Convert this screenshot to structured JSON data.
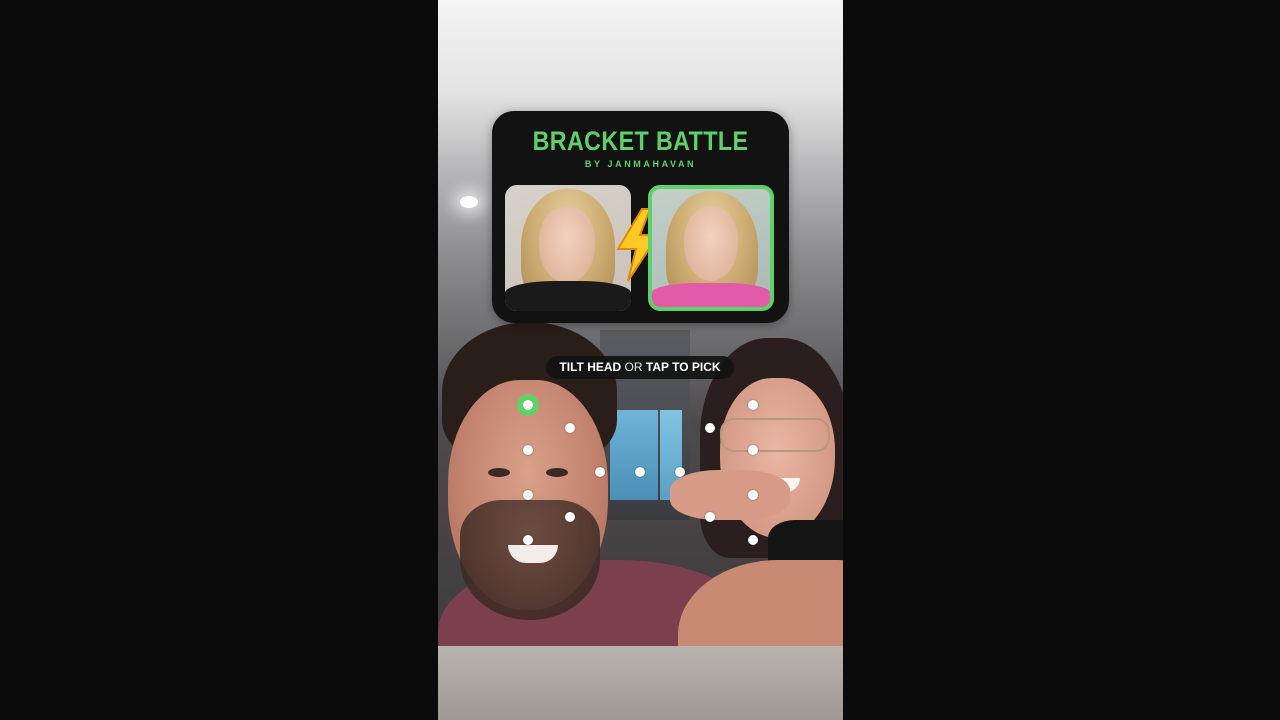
{
  "card": {
    "title": "BRACKET BATTLE",
    "subtitle": "BY JANMAHAVAN",
    "left_pick_name": "left-contestant",
    "right_pick_name": "right-contestant",
    "selected": "right",
    "versus_icon": "lightning-bolt-icon"
  },
  "instruction": {
    "part1": "TILT HEAD",
    "part2": "OR",
    "part3": "TAP TO PICK"
  },
  "colors": {
    "accent": "#5fd16b",
    "card_bg": "#121212",
    "letterbox": "#0b0b0b"
  }
}
